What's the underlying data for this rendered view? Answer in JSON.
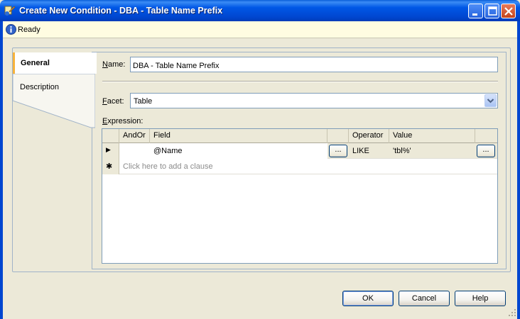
{
  "window": {
    "title": "Create New Condition - DBA - Table Name Prefix",
    "icon": "condition-app-icon",
    "controls": [
      "minimize-icon",
      "maximize-icon",
      "close-icon"
    ]
  },
  "status": {
    "icon": "info-icon",
    "text": "Ready"
  },
  "nav": {
    "items": [
      {
        "label": "General",
        "selected": true
      },
      {
        "label": "Description",
        "selected": false
      }
    ]
  },
  "form": {
    "name_label_accel": "N",
    "name_label_rest": "ame:",
    "name_value": "DBA - Table Name Prefix",
    "facet_label_accel": "F",
    "facet_label_rest": "acet:",
    "facet_value": "Table",
    "expression_label_accel": "E",
    "expression_label_rest": "xpression:"
  },
  "grid": {
    "columns": [
      "AndOr",
      "Field",
      "",
      "Operator",
      "Value",
      ""
    ],
    "rows": [
      {
        "marker": "▶",
        "andor": "",
        "field": "@Name",
        "operator": "LIKE",
        "value": "'tbl%'"
      }
    ],
    "new_row_marker": "✱",
    "new_row_placeholder": "Click here to add a clause",
    "ellipsis": "..."
  },
  "buttons": {
    "ok": "OK",
    "cancel": "Cancel",
    "help": "Help"
  },
  "colors": {
    "title_bar": "#0054e3",
    "tab_accent": "#f7b33b",
    "status_bg": "#fffce1"
  }
}
